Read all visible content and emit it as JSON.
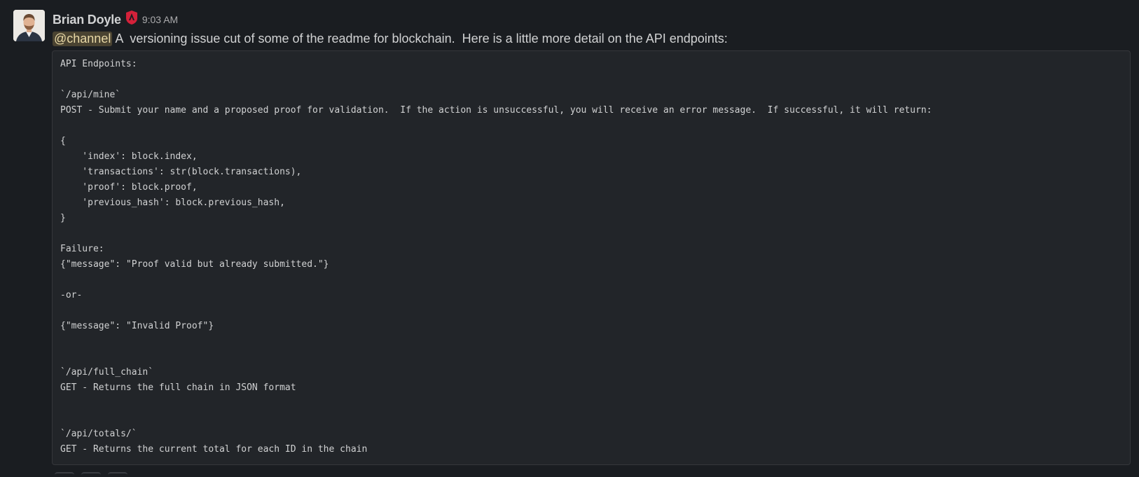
{
  "message": {
    "author": "Brian Doyle",
    "badge_icon": "shield-badge-icon",
    "timestamp": "9:03 AM",
    "mention": "@channel",
    "text": " A  versioning issue cut of some of the readme for blockchain.  Here is a little more detail on the API endpoints:",
    "code_lines": [
      "API Endpoints:",
      "",
      "`/api/mine`",
      "POST - Submit your name and a proposed proof for validation.  If the action is unsuccessful, you will receive an error message.  If successful, it will return:",
      "",
      "{",
      "    'index': block.index,",
      "    'transactions': str(block.transactions),",
      "    'proof': block.proof,",
      "    'previous_hash': block.previous_hash,",
      "}",
      "",
      "Failure:",
      "{\"message\": \"Proof valid but already submitted.\"}",
      "",
      "-or-",
      "",
      "{\"message\": \"Invalid Proof\"}",
      "",
      "",
      "`/api/full_chain`",
      "GET - Returns the full chain in JSON format",
      "",
      "",
      "`/api/totals/`",
      "GET - Returns the current total for each ID in the chain"
    ]
  },
  "colors": {
    "background": "#1a1d21",
    "code_background": "#222529",
    "mention_background": "#4a4331",
    "badge": "#d4213a"
  }
}
